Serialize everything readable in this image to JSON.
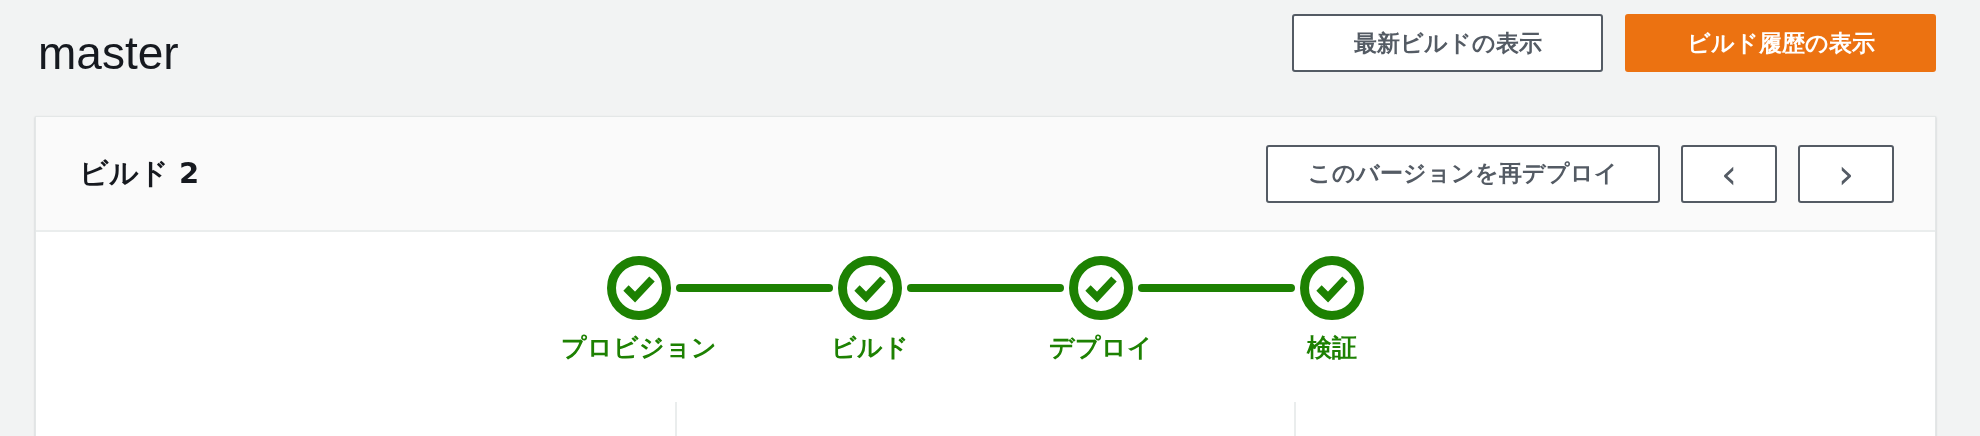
{
  "page": {
    "title": "master",
    "buttons": [
      {
        "label": "最新ビルドの表示",
        "kind": "normal"
      },
      {
        "label": "ビルド履歴の表示",
        "kind": "primary"
      }
    ]
  },
  "build": {
    "title": "ビルド 2",
    "redeploy_button": "このバージョンを再デプロイ",
    "prev_button": "‹",
    "next_button": "›",
    "steps": [
      {
        "label": "プロビジョン",
        "complete": true
      },
      {
        "label": "ビルド",
        "complete": true
      },
      {
        "label": "デプロイ",
        "complete": true
      },
      {
        "label": "検証",
        "complete": true
      }
    ]
  }
}
